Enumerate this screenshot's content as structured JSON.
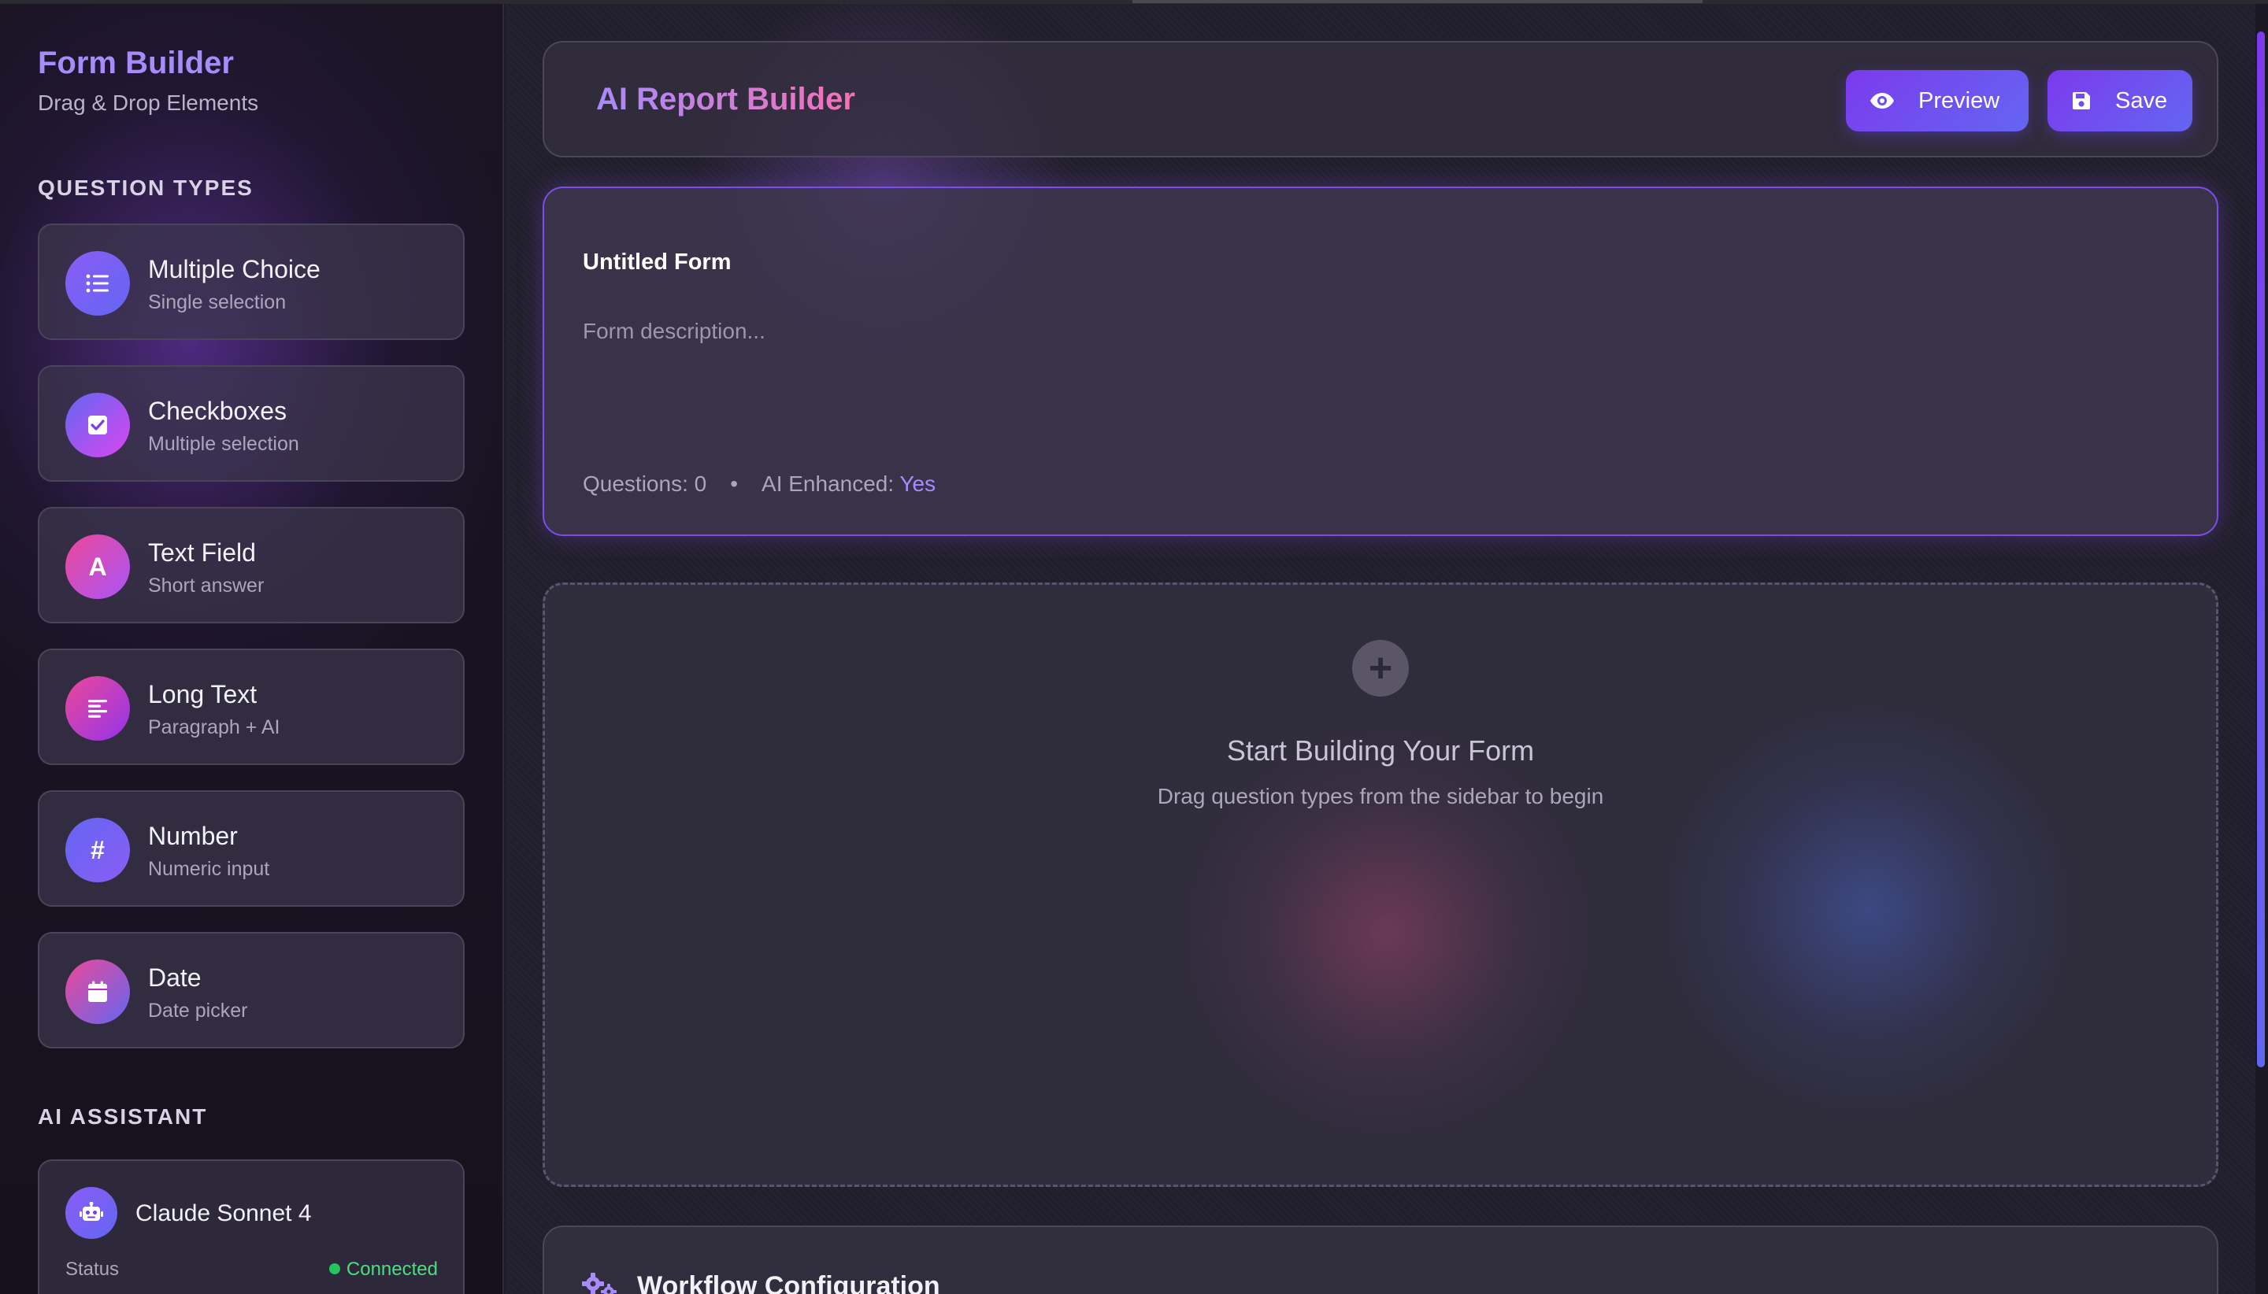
{
  "sidebar": {
    "title": "Form Builder",
    "subtitle": "Drag & Drop Elements",
    "question_types_label": "QUESTION TYPES",
    "question_types": [
      {
        "label": "Multiple Choice",
        "sub": "Single selection",
        "icon": "list-icon"
      },
      {
        "label": "Checkboxes",
        "sub": "Multiple selection",
        "icon": "checkbox-icon"
      },
      {
        "label": "Text Field",
        "sub": "Short answer",
        "icon": "A",
        "icon_name": "text-a-icon"
      },
      {
        "label": "Long Text",
        "sub": "Paragraph + AI",
        "icon": "paragraph-icon"
      },
      {
        "label": "Number",
        "sub": "Numeric input",
        "icon": "#",
        "icon_name": "hash-icon"
      },
      {
        "label": "Date",
        "sub": "Date picker",
        "icon": "calendar-icon"
      }
    ],
    "ai_assistant_label": "AI ASSISTANT",
    "ai_assistant": {
      "model": "Claude Sonnet 4",
      "status_label": "Status",
      "status_value": "Connected",
      "icon": "robot-icon"
    }
  },
  "header": {
    "title": "AI Report Builder",
    "preview_label": "Preview",
    "save_label": "Save"
  },
  "form": {
    "title": "Untitled Form",
    "description_placeholder": "Form description...",
    "questions_label": "Questions: 0",
    "separator": "•",
    "ai_label": "AI Enhanced:",
    "ai_value": "Yes"
  },
  "dropzone": {
    "plus": "+",
    "title": "Start Building Your Form",
    "subtitle": "Drag question types from the sidebar to begin"
  },
  "workflow": {
    "title": "Workflow Configuration",
    "icon": "gears-icon"
  },
  "colors": {
    "accent": "#7c3aed",
    "accent2": "#6366f1",
    "brand_text": "#a78bfa",
    "status_ok": "#22c55e"
  }
}
